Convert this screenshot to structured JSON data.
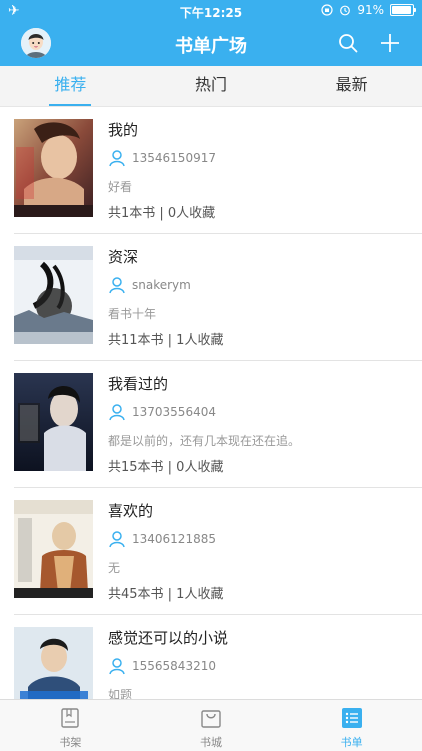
{
  "status_bar": {
    "time": "下午12:25",
    "battery": "91%"
  },
  "nav": {
    "title": "书单广场"
  },
  "tabs": [
    {
      "label": "推荐",
      "active": true
    },
    {
      "label": "热门",
      "active": false
    },
    {
      "label": "最新",
      "active": false
    }
  ],
  "booklists": [
    {
      "name": "我的",
      "user": "13546150917",
      "desc": "好看",
      "stats": "共1本书 | 0人收藏",
      "cover": "cover-1"
    },
    {
      "name": "资深",
      "user": "snakerym",
      "desc": "看书十年",
      "stats": "共11本书 | 1人收藏",
      "cover": "cover-2"
    },
    {
      "name": "我看过的",
      "user": "13703556404",
      "desc": "都是以前的，还有几本现在还在追。",
      "stats": "共15本书 | 0人收藏",
      "cover": "cover-3"
    },
    {
      "name": "喜欢的",
      "user": "13406121885",
      "desc": "无",
      "stats": "共45本书 | 1人收藏",
      "cover": "cover-4"
    },
    {
      "name": "感觉还可以的小说",
      "user": "15565843210",
      "desc": "如题",
      "stats": "",
      "cover": "cover-5"
    }
  ],
  "bottom_tabs": [
    {
      "label": "书架",
      "icon": "bookshelf-icon",
      "active": false
    },
    {
      "label": "书城",
      "icon": "bookstore-bag-icon",
      "active": false
    },
    {
      "label": "书单",
      "icon": "booklist-icon",
      "active": true
    }
  ],
  "colors": {
    "accent": "#3ab0ef",
    "tab_bg": "#f4f4f4"
  }
}
